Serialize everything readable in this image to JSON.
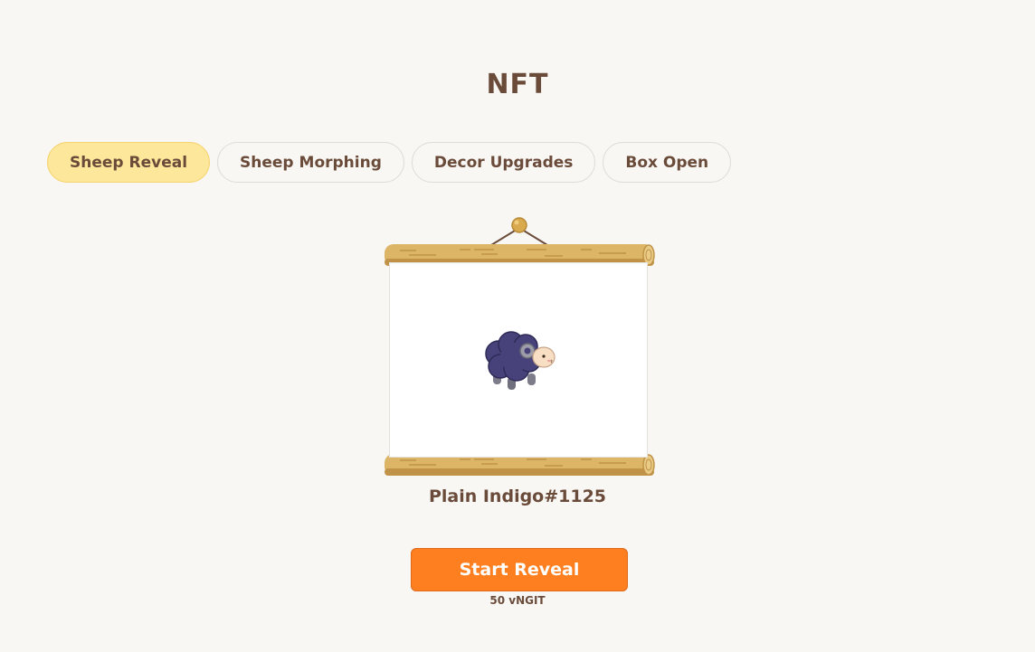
{
  "header": {
    "title": "NFT"
  },
  "tabs": [
    {
      "label": "Sheep Reveal",
      "active": true
    },
    {
      "label": "Sheep Morphing",
      "active": false
    },
    {
      "label": "Decor Upgrades",
      "active": false
    },
    {
      "label": "Box Open",
      "active": false
    }
  ],
  "nft": {
    "name": "Plain Indigo#1125",
    "image": "indigo-sheep-icon"
  },
  "action": {
    "button_label": "Start Reveal",
    "cost": "50 vNGIT"
  },
  "colors": {
    "background": "#f9f7f4",
    "text": "#6a4b3a",
    "active_tab": "#fde79a",
    "button": "#fe7f20",
    "log": "#dcb566"
  }
}
